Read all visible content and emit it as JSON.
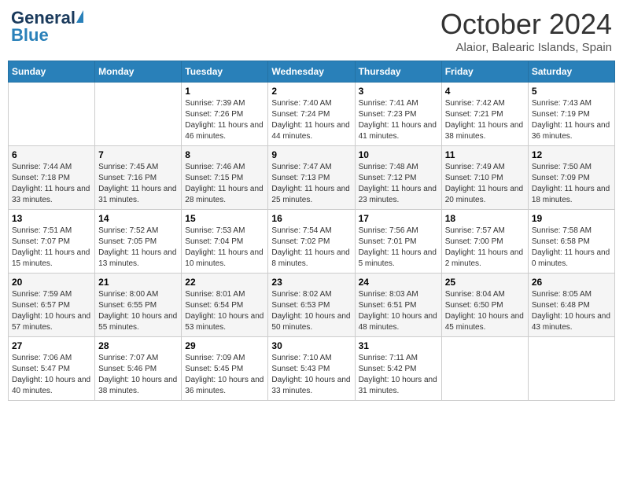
{
  "header": {
    "logo_general": "General",
    "logo_blue": "Blue",
    "month_title": "October 2024",
    "location": "Alaior, Balearic Islands, Spain"
  },
  "days_of_week": [
    "Sunday",
    "Monday",
    "Tuesday",
    "Wednesday",
    "Thursday",
    "Friday",
    "Saturday"
  ],
  "weeks": [
    [
      {
        "day": "",
        "sunrise": "",
        "sunset": "",
        "daylight": ""
      },
      {
        "day": "",
        "sunrise": "",
        "sunset": "",
        "daylight": ""
      },
      {
        "day": "1",
        "sunrise": "Sunrise: 7:39 AM",
        "sunset": "Sunset: 7:26 PM",
        "daylight": "Daylight: 11 hours and 46 minutes."
      },
      {
        "day": "2",
        "sunrise": "Sunrise: 7:40 AM",
        "sunset": "Sunset: 7:24 PM",
        "daylight": "Daylight: 11 hours and 44 minutes."
      },
      {
        "day": "3",
        "sunrise": "Sunrise: 7:41 AM",
        "sunset": "Sunset: 7:23 PM",
        "daylight": "Daylight: 11 hours and 41 minutes."
      },
      {
        "day": "4",
        "sunrise": "Sunrise: 7:42 AM",
        "sunset": "Sunset: 7:21 PM",
        "daylight": "Daylight: 11 hours and 38 minutes."
      },
      {
        "day": "5",
        "sunrise": "Sunrise: 7:43 AM",
        "sunset": "Sunset: 7:19 PM",
        "daylight": "Daylight: 11 hours and 36 minutes."
      }
    ],
    [
      {
        "day": "6",
        "sunrise": "Sunrise: 7:44 AM",
        "sunset": "Sunset: 7:18 PM",
        "daylight": "Daylight: 11 hours and 33 minutes."
      },
      {
        "day": "7",
        "sunrise": "Sunrise: 7:45 AM",
        "sunset": "Sunset: 7:16 PM",
        "daylight": "Daylight: 11 hours and 31 minutes."
      },
      {
        "day": "8",
        "sunrise": "Sunrise: 7:46 AM",
        "sunset": "Sunset: 7:15 PM",
        "daylight": "Daylight: 11 hours and 28 minutes."
      },
      {
        "day": "9",
        "sunrise": "Sunrise: 7:47 AM",
        "sunset": "Sunset: 7:13 PM",
        "daylight": "Daylight: 11 hours and 25 minutes."
      },
      {
        "day": "10",
        "sunrise": "Sunrise: 7:48 AM",
        "sunset": "Sunset: 7:12 PM",
        "daylight": "Daylight: 11 hours and 23 minutes."
      },
      {
        "day": "11",
        "sunrise": "Sunrise: 7:49 AM",
        "sunset": "Sunset: 7:10 PM",
        "daylight": "Daylight: 11 hours and 20 minutes."
      },
      {
        "day": "12",
        "sunrise": "Sunrise: 7:50 AM",
        "sunset": "Sunset: 7:09 PM",
        "daylight": "Daylight: 11 hours and 18 minutes."
      }
    ],
    [
      {
        "day": "13",
        "sunrise": "Sunrise: 7:51 AM",
        "sunset": "Sunset: 7:07 PM",
        "daylight": "Daylight: 11 hours and 15 minutes."
      },
      {
        "day": "14",
        "sunrise": "Sunrise: 7:52 AM",
        "sunset": "Sunset: 7:05 PM",
        "daylight": "Daylight: 11 hours and 13 minutes."
      },
      {
        "day": "15",
        "sunrise": "Sunrise: 7:53 AM",
        "sunset": "Sunset: 7:04 PM",
        "daylight": "Daylight: 11 hours and 10 minutes."
      },
      {
        "day": "16",
        "sunrise": "Sunrise: 7:54 AM",
        "sunset": "Sunset: 7:02 PM",
        "daylight": "Daylight: 11 hours and 8 minutes."
      },
      {
        "day": "17",
        "sunrise": "Sunrise: 7:56 AM",
        "sunset": "Sunset: 7:01 PM",
        "daylight": "Daylight: 11 hours and 5 minutes."
      },
      {
        "day": "18",
        "sunrise": "Sunrise: 7:57 AM",
        "sunset": "Sunset: 7:00 PM",
        "daylight": "Daylight: 11 hours and 2 minutes."
      },
      {
        "day": "19",
        "sunrise": "Sunrise: 7:58 AM",
        "sunset": "Sunset: 6:58 PM",
        "daylight": "Daylight: 11 hours and 0 minutes."
      }
    ],
    [
      {
        "day": "20",
        "sunrise": "Sunrise: 7:59 AM",
        "sunset": "Sunset: 6:57 PM",
        "daylight": "Daylight: 10 hours and 57 minutes."
      },
      {
        "day": "21",
        "sunrise": "Sunrise: 8:00 AM",
        "sunset": "Sunset: 6:55 PM",
        "daylight": "Daylight: 10 hours and 55 minutes."
      },
      {
        "day": "22",
        "sunrise": "Sunrise: 8:01 AM",
        "sunset": "Sunset: 6:54 PM",
        "daylight": "Daylight: 10 hours and 53 minutes."
      },
      {
        "day": "23",
        "sunrise": "Sunrise: 8:02 AM",
        "sunset": "Sunset: 6:53 PM",
        "daylight": "Daylight: 10 hours and 50 minutes."
      },
      {
        "day": "24",
        "sunrise": "Sunrise: 8:03 AM",
        "sunset": "Sunset: 6:51 PM",
        "daylight": "Daylight: 10 hours and 48 minutes."
      },
      {
        "day": "25",
        "sunrise": "Sunrise: 8:04 AM",
        "sunset": "Sunset: 6:50 PM",
        "daylight": "Daylight: 10 hours and 45 minutes."
      },
      {
        "day": "26",
        "sunrise": "Sunrise: 8:05 AM",
        "sunset": "Sunset: 6:48 PM",
        "daylight": "Daylight: 10 hours and 43 minutes."
      }
    ],
    [
      {
        "day": "27",
        "sunrise": "Sunrise: 7:06 AM",
        "sunset": "Sunset: 5:47 PM",
        "daylight": "Daylight: 10 hours and 40 minutes."
      },
      {
        "day": "28",
        "sunrise": "Sunrise: 7:07 AM",
        "sunset": "Sunset: 5:46 PM",
        "daylight": "Daylight: 10 hours and 38 minutes."
      },
      {
        "day": "29",
        "sunrise": "Sunrise: 7:09 AM",
        "sunset": "Sunset: 5:45 PM",
        "daylight": "Daylight: 10 hours and 36 minutes."
      },
      {
        "day": "30",
        "sunrise": "Sunrise: 7:10 AM",
        "sunset": "Sunset: 5:43 PM",
        "daylight": "Daylight: 10 hours and 33 minutes."
      },
      {
        "day": "31",
        "sunrise": "Sunrise: 7:11 AM",
        "sunset": "Sunset: 5:42 PM",
        "daylight": "Daylight: 10 hours and 31 minutes."
      },
      {
        "day": "",
        "sunrise": "",
        "sunset": "",
        "daylight": ""
      },
      {
        "day": "",
        "sunrise": "",
        "sunset": "",
        "daylight": ""
      }
    ]
  ]
}
